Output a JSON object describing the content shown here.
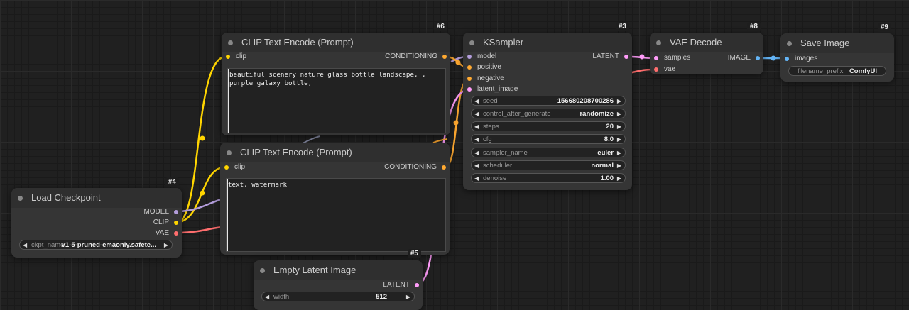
{
  "colors": {
    "clip": "#ffd500",
    "conditioning": "#ffa931",
    "latent": "#ff9cf9",
    "model": "#b39ddb",
    "vae": "#ff6e6e",
    "image": "#64b5f6"
  },
  "nodes": {
    "load_checkpoint": {
      "id": "#4",
      "title": "Load Checkpoint",
      "outputs": [
        "MODEL",
        "CLIP",
        "VAE"
      ],
      "ckpt_name": {
        "label": "ckpt_name",
        "value": "v1-5-pruned-emaonly.safete..."
      }
    },
    "clip_pos": {
      "id": "#6",
      "title": "CLIP Text Encode (Prompt)",
      "input": "clip",
      "output": "CONDITIONING",
      "text": "beautiful scenery nature glass bottle landscape, , purple galaxy bottle,"
    },
    "clip_neg": {
      "id": "#7",
      "title": "CLIP Text Encode (Prompt)",
      "input": "clip",
      "output": "CONDITIONING",
      "text": "text, watermark"
    },
    "empty_latent": {
      "id": "#5",
      "title": "Empty Latent Image",
      "output": "LATENT",
      "width": {
        "label": "width",
        "value": "512"
      }
    },
    "ksampler": {
      "id": "#3",
      "title": "KSampler",
      "inputs": [
        "model",
        "positive",
        "negative",
        "latent_image"
      ],
      "output": "LATENT",
      "widgets": [
        {
          "label": "seed",
          "value": "156680208700286"
        },
        {
          "label": "control_after_generate",
          "value": "randomize"
        },
        {
          "label": "steps",
          "value": "20"
        },
        {
          "label": "cfg",
          "value": "8.0"
        },
        {
          "label": "sampler_name",
          "value": "euler"
        },
        {
          "label": "scheduler",
          "value": "normal"
        },
        {
          "label": "denoise",
          "value": "1.00"
        }
      ]
    },
    "vae_decode": {
      "id": "#8",
      "title": "VAE Decode",
      "inputs": [
        "samples",
        "vae"
      ],
      "output": "IMAGE"
    },
    "save_image": {
      "id": "#9",
      "title": "Save Image",
      "input": "images",
      "filename_prefix": {
        "label": "filename_prefix",
        "value": "ComfyUI"
      }
    }
  }
}
